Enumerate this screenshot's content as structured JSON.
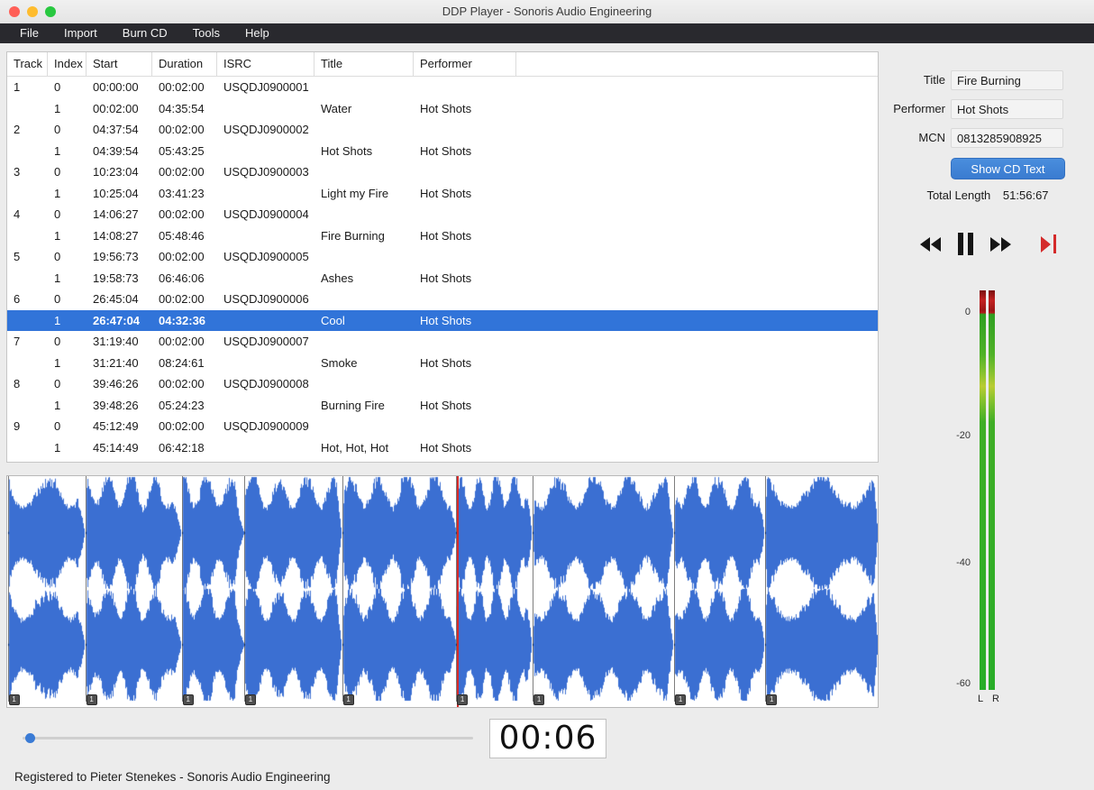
{
  "window": {
    "title": "DDP Player - Sonoris Audio Engineering"
  },
  "menu": {
    "items": [
      "File",
      "Import",
      "Burn CD",
      "Tools",
      "Help"
    ]
  },
  "table": {
    "columns": [
      "Track",
      "Index",
      "Start",
      "Duration",
      "ISRC",
      "Title",
      "Performer"
    ],
    "rows": [
      {
        "track": "1",
        "index": "0",
        "start": "00:00:00",
        "duration": "00:02:00",
        "isrc": "USQDJ0900001",
        "title": "",
        "performer": "",
        "selected": false
      },
      {
        "track": "",
        "index": "1",
        "start": "00:02:00",
        "duration": "04:35:54",
        "isrc": "",
        "title": "Water",
        "performer": "Hot Shots",
        "selected": false
      },
      {
        "track": "2",
        "index": "0",
        "start": "04:37:54",
        "duration": "00:02:00",
        "isrc": "USQDJ0900002",
        "title": "",
        "performer": "",
        "selected": false
      },
      {
        "track": "",
        "index": "1",
        "start": "04:39:54",
        "duration": "05:43:25",
        "isrc": "",
        "title": "Hot Shots",
        "performer": "Hot Shots",
        "selected": false
      },
      {
        "track": "3",
        "index": "0",
        "start": "10:23:04",
        "duration": "00:02:00",
        "isrc": "USQDJ0900003",
        "title": "",
        "performer": "",
        "selected": false
      },
      {
        "track": "",
        "index": "1",
        "start": "10:25:04",
        "duration": "03:41:23",
        "isrc": "",
        "title": "Light my Fire",
        "performer": "Hot Shots",
        "selected": false
      },
      {
        "track": "4",
        "index": "0",
        "start": "14:06:27",
        "duration": "00:02:00",
        "isrc": "USQDJ0900004",
        "title": "",
        "performer": "",
        "selected": false
      },
      {
        "track": "",
        "index": "1",
        "start": "14:08:27",
        "duration": "05:48:46",
        "isrc": "",
        "title": "Fire Burning",
        "performer": "Hot Shots",
        "selected": false
      },
      {
        "track": "5",
        "index": "0",
        "start": "19:56:73",
        "duration": "00:02:00",
        "isrc": "USQDJ0900005",
        "title": "",
        "performer": "",
        "selected": false
      },
      {
        "track": "",
        "index": "1",
        "start": "19:58:73",
        "duration": "06:46:06",
        "isrc": "",
        "title": "Ashes",
        "performer": "Hot Shots",
        "selected": false
      },
      {
        "track": "6",
        "index": "0",
        "start": "26:45:04",
        "duration": "00:02:00",
        "isrc": "USQDJ0900006",
        "title": "",
        "performer": "",
        "selected": false
      },
      {
        "track": "",
        "index": "1",
        "start": "26:47:04",
        "duration": "04:32:36",
        "isrc": "",
        "title": "Cool",
        "performer": "Hot Shots",
        "selected": true
      },
      {
        "track": "7",
        "index": "0",
        "start": "31:19:40",
        "duration": "00:02:00",
        "isrc": "USQDJ0900007",
        "title": "",
        "performer": "",
        "selected": false
      },
      {
        "track": "",
        "index": "1",
        "start": "31:21:40",
        "duration": "08:24:61",
        "isrc": "",
        "title": "Smoke",
        "performer": "Hot Shots",
        "selected": false
      },
      {
        "track": "8",
        "index": "0",
        "start": "39:46:26",
        "duration": "00:02:00",
        "isrc": "USQDJ0900008",
        "title": "",
        "performer": "",
        "selected": false
      },
      {
        "track": "",
        "index": "1",
        "start": "39:48:26",
        "duration": "05:24:23",
        "isrc": "",
        "title": "Burning Fire",
        "performer": "Hot Shots",
        "selected": false
      },
      {
        "track": "9",
        "index": "0",
        "start": "45:12:49",
        "duration": "00:02:00",
        "isrc": "USQDJ0900009",
        "title": "",
        "performer": "",
        "selected": false
      },
      {
        "track": "",
        "index": "1",
        "start": "45:14:49",
        "duration": "06:42:18",
        "isrc": "",
        "title": "Hot, Hot, Hot",
        "performer": "Hot Shots",
        "selected": false
      }
    ]
  },
  "details": {
    "title_label": "Title",
    "title_value": "Fire Burning",
    "performer_label": "Performer",
    "performer_value": "Hot Shots",
    "mcn_label": "MCN",
    "mcn_value": "0813285908925",
    "show_cd_text_label": "Show CD Text",
    "total_length_label": "Total Length",
    "total_length_value": "51:56:67"
  },
  "transport": {
    "buttons": [
      "rewind-icon",
      "pause-icon",
      "fast-forward-icon",
      "skip-to-end-icon"
    ]
  },
  "meter": {
    "scale": [
      "0",
      "-20",
      "-40",
      "-60"
    ],
    "channel_left": "L",
    "channel_right": "R"
  },
  "playback": {
    "time": "00:06"
  },
  "waveform": {
    "marker_label": "1",
    "cursor_fraction": 0.517,
    "segments": [
      {
        "x": 0.0006,
        "w": 0.0885,
        "fade": 0.1
      },
      {
        "x": 0.0897,
        "w": 0.1102,
        "fade": 0.14
      },
      {
        "x": 0.2005,
        "w": 0.071,
        "fade": 0.16
      },
      {
        "x": 0.2722,
        "w": 0.1118,
        "fade": 0.06
      },
      {
        "x": 0.3847,
        "w": 0.1303,
        "fade": 0.06
      },
      {
        "x": 0.5156,
        "w": 0.0874,
        "fade": 0.08
      },
      {
        "x": 0.6036,
        "w": 0.162,
        "fade": 0.05
      },
      {
        "x": 0.7662,
        "w": 0.104,
        "fade": 0.06
      },
      {
        "x": 0.8709,
        "w": 0.1291,
        "fade": 0.04
      }
    ]
  },
  "status": {
    "text": "Registered to Pieter Stenekes - Sonoris Audio Engineering"
  },
  "colors": {
    "accent_blue": "#3a7bd5",
    "selection": "#3174d9",
    "waveform": "#3b6fd2",
    "cursor": "#d42a2a",
    "button_blue": "#4a8edd",
    "meter_green": "#28ad28",
    "meter_red": "#c32222",
    "traffic_red": "#ff5f57",
    "traffic_yellow": "#febc2e",
    "traffic_green": "#28c840"
  }
}
